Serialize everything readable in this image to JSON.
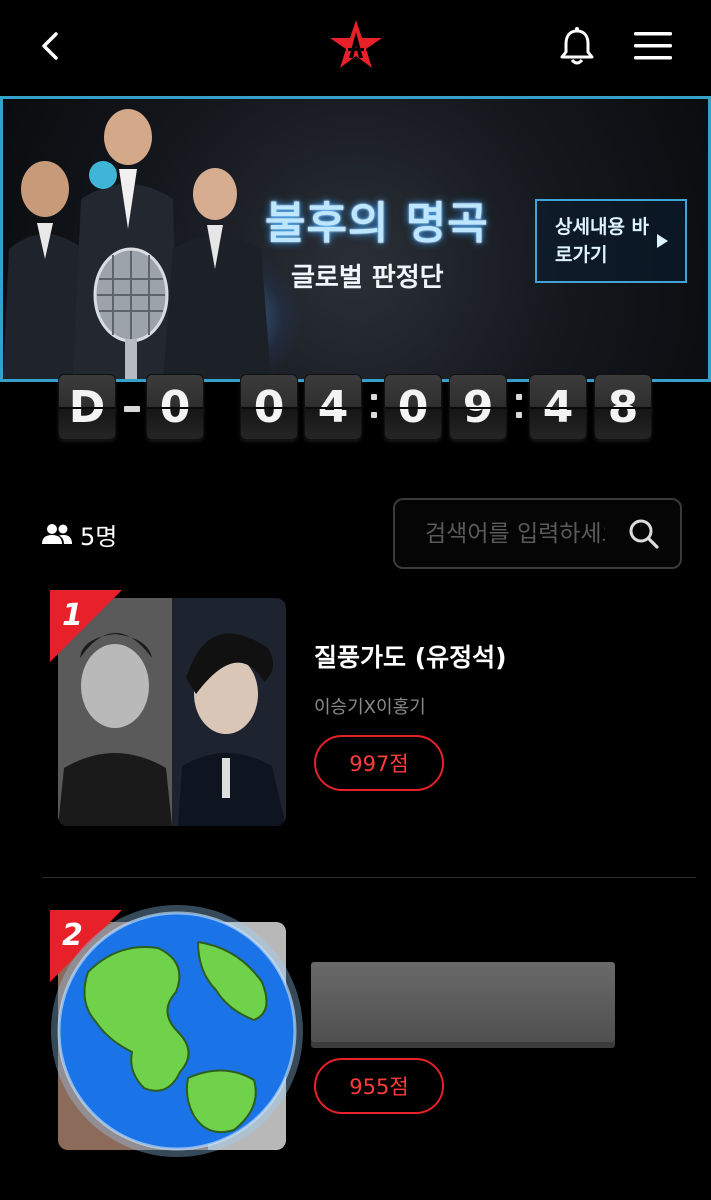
{
  "header": {
    "back_icon": "chevron-left-icon",
    "logo_icon": "red-star-a-logo",
    "bell_icon": "bell-icon",
    "menu_icon": "hamburger-menu-icon"
  },
  "banner": {
    "title": "불후의 명곡",
    "subtitle": "글로벌 판정단",
    "cta_label": "상세내용 바로가기",
    "accent": "#35a0c9"
  },
  "countdown": {
    "day_prefix": "D",
    "days": "0",
    "hours": [
      "0",
      "4"
    ],
    "minutes": [
      "0",
      "9"
    ],
    "seconds": [
      "4",
      "8"
    ]
  },
  "participants": {
    "count_label": "5명",
    "icon": "people-icon"
  },
  "search": {
    "placeholder": "검색어를 입력하세요",
    "icon": "search-icon"
  },
  "entries": [
    {
      "rank": "1",
      "title": "질풍가도 (유정석)",
      "artist": "이승기X이홍기",
      "score": "997점"
    },
    {
      "rank": "2",
      "title": "",
      "artist": "",
      "score": "955점"
    }
  ],
  "colors": {
    "rank_red": "#e8202a",
    "background": "#000000"
  }
}
